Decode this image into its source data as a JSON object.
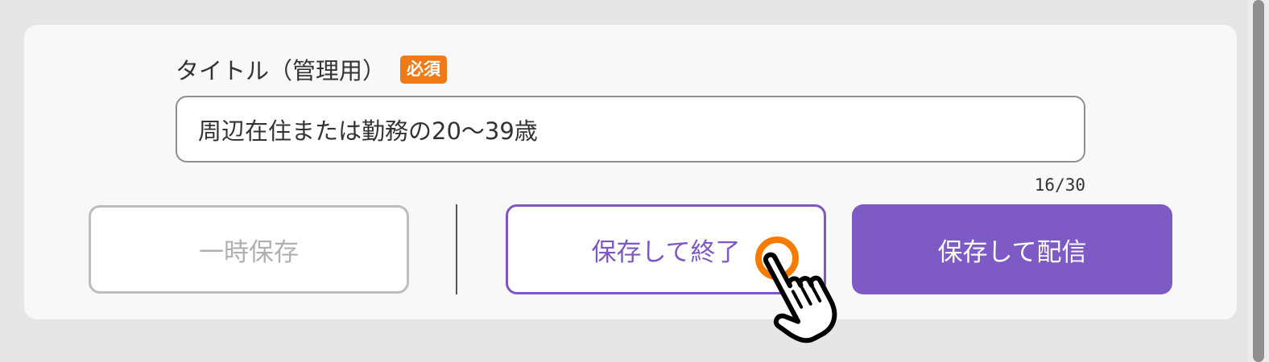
{
  "form": {
    "title_label": "タイトル（管理用）",
    "required_badge": "必須",
    "title_value": "周辺在住または勤務の20〜39歳",
    "char_count": "16/30"
  },
  "actions": {
    "temp_save_label": "一時保存",
    "save_exit_label": "保存して終了",
    "save_publish_label": "保存して配信"
  },
  "colors": {
    "accent_purple": "#7e57c2",
    "badge_orange": "#f07a15",
    "disabled_gray": "#b0b0b0"
  },
  "icons": {
    "cursor": "hand-pointer-icon",
    "click_indicator": "click-ring-icon"
  }
}
